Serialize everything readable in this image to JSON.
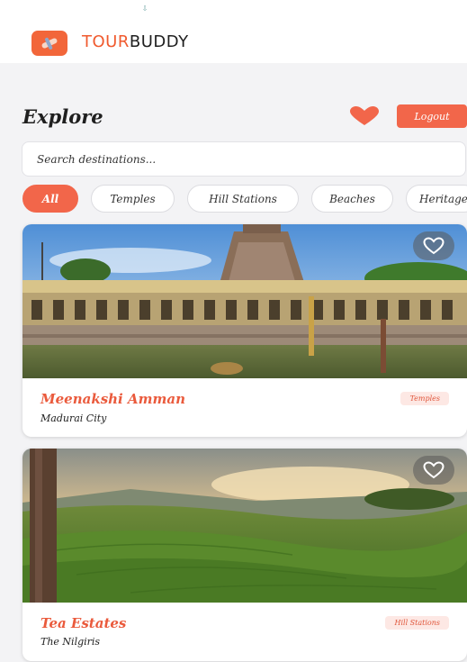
{
  "app": {
    "brand_part1": "TOUR",
    "brand_part2": "BUDDY",
    "accent_color": "#f2664a"
  },
  "header": {
    "title": "Explore",
    "logout_label": "Logout",
    "favorites_icon": "heart-icon"
  },
  "search": {
    "placeholder": "Search destinations..."
  },
  "categories": [
    {
      "label": "All",
      "active": true
    },
    {
      "label": "Temples",
      "active": false
    },
    {
      "label": "Hill Stations",
      "active": false
    },
    {
      "label": "Beaches",
      "active": false
    },
    {
      "label": "Heritage",
      "active": false
    }
  ],
  "destinations": [
    {
      "name": "Meenakshi Amman",
      "location": "Madurai City",
      "category": "Temples"
    },
    {
      "name": "Tea Estates",
      "location": "The Nilgiris",
      "category": "Hill Stations"
    }
  ]
}
